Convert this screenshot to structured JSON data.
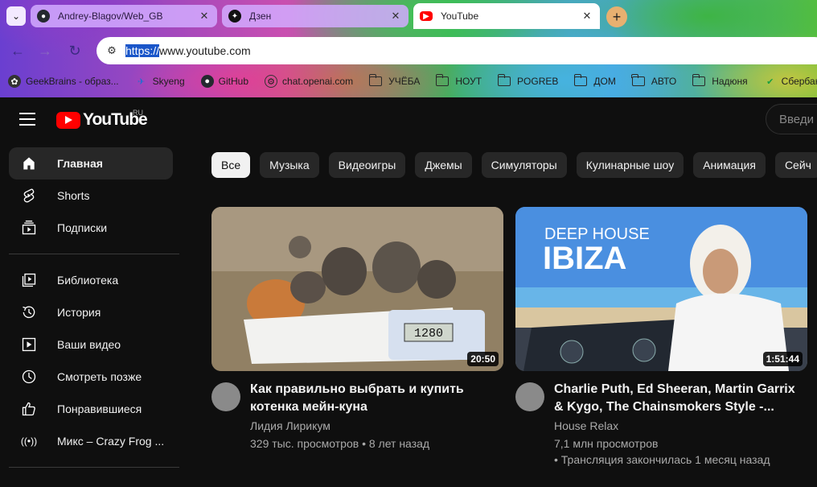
{
  "browser": {
    "tabs": [
      {
        "label": "Andrey-Blagov/Web_GB",
        "favicon": "github-icon"
      },
      {
        "label": "Дзен",
        "favicon": "dzen-icon"
      },
      {
        "label": "YouTube",
        "favicon": "youtube-icon",
        "active": true
      }
    ],
    "url_selected": "https://",
    "url_rest": "www.youtube.com",
    "bookmarks": [
      {
        "label": "GeekBrains - образ...",
        "icon": "geekbrains-icon"
      },
      {
        "label": "Skyeng",
        "icon": "skyeng-icon"
      },
      {
        "label": "GitHub",
        "icon": "github-icon"
      },
      {
        "label": "chat.openai.com",
        "icon": "openai-icon"
      },
      {
        "label": "УЧЁБА",
        "icon": "folder-icon"
      },
      {
        "label": "НОУТ",
        "icon": "folder-icon"
      },
      {
        "label": "POGREB",
        "icon": "folder-icon"
      },
      {
        "label": "ДОМ",
        "icon": "folder-icon"
      },
      {
        "label": "АВТО",
        "icon": "folder-icon"
      },
      {
        "label": "Надюня",
        "icon": "folder-icon"
      },
      {
        "label": "Сбербан",
        "icon": "sber-icon"
      }
    ]
  },
  "youtube": {
    "logo_text": "YouTube",
    "region": "RU",
    "search_placeholder": "Введи",
    "sidebar": [
      {
        "label": "Главная",
        "icon": "home-icon",
        "active": true
      },
      {
        "label": "Shorts",
        "icon": "shorts-icon"
      },
      {
        "label": "Подписки",
        "icon": "subscriptions-icon"
      },
      {
        "label": "Библиотека",
        "icon": "library-icon"
      },
      {
        "label": "История",
        "icon": "history-icon"
      },
      {
        "label": "Ваши видео",
        "icon": "your-videos-icon"
      },
      {
        "label": "Смотреть позже",
        "icon": "watch-later-icon"
      },
      {
        "label": "Понравившиеся",
        "icon": "liked-icon"
      },
      {
        "label": "Микс – Crazy Frog ...",
        "icon": "mix-icon"
      }
    ],
    "chips": [
      "Все",
      "Музыка",
      "Видеоигры",
      "Джемы",
      "Симуляторы",
      "Кулинарные шоу",
      "Анимация",
      "Сейч"
    ],
    "videos": [
      {
        "title": "Как правильно выбрать и купить котенка мейн-куна",
        "channel": "Лидия Лирикум",
        "stats": "329 тыс. просмотров • 8 лет назад",
        "duration": "20:50",
        "scale_reading": "1280"
      },
      {
        "title": "Charlie Puth, Ed Sheeran, Martin Garrix & Kygo, The Chainsmokers Style -...",
        "channel": "House Relax",
        "stats": "7,1 млн просмотров",
        "stats2": "• Трансляция закончилась 1 месяц назад",
        "duration": "1:51:44",
        "thumb_line1": "DEEP HOUSE",
        "thumb_line2": "IBIZA"
      }
    ]
  }
}
